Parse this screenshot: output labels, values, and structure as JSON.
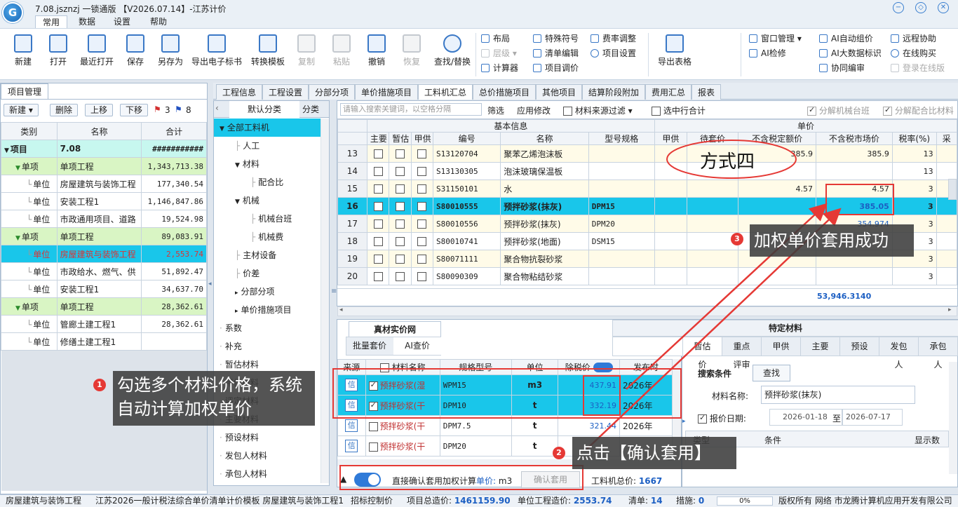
{
  "app": {
    "title": "7.08.jsznzj  一锁通版 【V2026.07.14】-江苏计价",
    "logo": "G"
  },
  "menu": [
    "常用",
    "数据",
    "设置",
    "帮助"
  ],
  "ribbon": {
    "big": [
      "新建",
      "打开",
      "最近打开",
      "保存",
      "另存为",
      "导出电子标书",
      "转换模板",
      "复制",
      "粘贴",
      "撤销",
      "恢复",
      "查找/替换"
    ],
    "small_col1": [
      "布局",
      "层级",
      "计算器"
    ],
    "small_col2": [
      "特殊符号",
      "清单编辑",
      "项目调价"
    ],
    "small_col3": [
      "费率调整",
      "项目设置"
    ],
    "export": "导出表格",
    "small_col4": [
      "窗口管理",
      "AI检修"
    ],
    "small_col5": [
      "AI自动组价",
      "AI大数据标识",
      "协同编审"
    ],
    "small_col6": [
      "远程协助",
      "在线购买",
      "登录在线版"
    ]
  },
  "left": {
    "tab": "项目管理",
    "buttons": [
      "新建",
      "删除",
      "上移",
      "下移"
    ],
    "flags": [
      "3",
      "8"
    ],
    "headers": [
      "类别",
      "名称",
      "合计"
    ],
    "rows": [
      {
        "cat": "项目",
        "name": "7.08",
        "total": "###########",
        "lvl": 0
      },
      {
        "cat": "单项",
        "name": "单项工程",
        "total": "1,343,713.38",
        "lvl": 1
      },
      {
        "cat": "单位",
        "name": "房屋建筑与装饰工程",
        "total": "177,340.54",
        "lvl": 2
      },
      {
        "cat": "单位",
        "name": "安装工程1",
        "total": "1,146,847.86",
        "lvl": 2
      },
      {
        "cat": "单位",
        "name": "市政通用项目、道路",
        "total": "19,524.98",
        "lvl": 2
      },
      {
        "cat": "单项",
        "name": "单项工程",
        "total": "89,083.91",
        "lvl": 1
      },
      {
        "cat": "单位",
        "name": "房屋建筑与装饰工程",
        "total": "2,553.74",
        "lvl": 2
      },
      {
        "cat": "单位",
        "name": "市政给水、燃气、供",
        "total": "51,892.47",
        "lvl": 2
      },
      {
        "cat": "单位",
        "name": "安装工程1",
        "total": "34,637.70",
        "lvl": 2
      },
      {
        "cat": "单项",
        "name": "单项工程",
        "total": "28,362.61",
        "lvl": 1
      },
      {
        "cat": "单位",
        "name": "管廊土建工程1",
        "total": "28,362.61",
        "lvl": 2
      },
      {
        "cat": "单位",
        "name": "修缮土建工程1",
        "total": "",
        "lvl": 2
      }
    ]
  },
  "tabs": [
    "工程信息",
    "工程设置",
    "分部分项",
    "单价措施项目",
    "工料机汇总",
    "总价措施项目",
    "其他项目",
    "结算阶段附加",
    "费用汇总",
    "报表"
  ],
  "mid": {
    "tabs": [
      "默认分类",
      "分类"
    ],
    "tree": [
      "全部工料机",
      "人工",
      "材料",
      "配合比",
      "机械",
      "机械台班",
      "机械费",
      "主材设备",
      "价差",
      "分部分项",
      "单价措施项目",
      "系数",
      "补充",
      "暂估材料",
      "甲供材料",
      "评定材料",
      "主要材料",
      "预设材料",
      "发包人材料",
      "承包人材料"
    ]
  },
  "toolbar": {
    "search_placeholder": "请输入搜索关键词，以空格分隔",
    "filter": "筛选",
    "apply": "应用修改",
    "source_filter": "材料来源过滤",
    "sel_total": "选中行合计",
    "split_machine": "分解机械台班",
    "split_mix": "分解配合比材料"
  },
  "table": {
    "group1": "基本信息",
    "group2": "单价",
    "headers": [
      "主要",
      "暂估",
      "甲供",
      "编号",
      "名称",
      "型号规格",
      "甲供",
      "待套价",
      "不含税定额价",
      "不含税市场价",
      "税率(%)",
      "采"
    ],
    "rows": [
      {
        "no": "13",
        "code": "S13120704",
        "name": "聚苯乙烯泡沫板",
        "spec": "",
        "quota": "385.9",
        "market": "385.9",
        "tax": "13"
      },
      {
        "no": "14",
        "code": "S13130305",
        "name": "泡沫玻璃保温板",
        "spec": "",
        "quota": "",
        "market": "",
        "tax": "13"
      },
      {
        "no": "15",
        "code": "S31150101",
        "name": "水",
        "spec": "",
        "quota": "4.57",
        "market": "4.57",
        "tax": "3"
      },
      {
        "no": "16",
        "code": "S80010555",
        "name": "预拌砂浆(抹灰)",
        "spec": "DPM15",
        "quota": "",
        "market": "385.05",
        "tax": "3"
      },
      {
        "no": "17",
        "code": "S80010556",
        "name": "预拌砂浆(抹灰)",
        "spec": "DPM20",
        "quota": "",
        "market": "354.974",
        "tax": "3"
      },
      {
        "no": "18",
        "code": "S80010741",
        "name": "预拌砂浆(地面)",
        "spec": "DSM15",
        "quota": "",
        "market": "",
        "tax": "3"
      },
      {
        "no": "19",
        "code": "S80071111",
        "name": "聚合物抗裂砂浆",
        "spec": "",
        "quota": "",
        "market": "",
        "tax": "3"
      },
      {
        "no": "20",
        "code": "S80090309",
        "name": "聚合物粘结砂浆",
        "spec": "",
        "quota": "",
        "market": "",
        "tax": "3"
      }
    ],
    "total": "53,946.3140"
  },
  "bottom": {
    "title": "真材实价网",
    "tabs": [
      "批量套价",
      "AI查价"
    ],
    "headers": [
      "来源",
      "材料名称",
      "规格型号",
      "单位",
      "除税价",
      "发布时"
    ],
    "rows": [
      {
        "src": "信",
        "name": "预拌砂浆(湿",
        "spec": "WPM15",
        "unit": "m3",
        "price": "437.91",
        "date": "2026年",
        "checked": true
      },
      {
        "src": "信",
        "name": "预拌砂浆(干",
        "spec": "DPM10",
        "unit": "t",
        "price": "332.19",
        "date": "2026年",
        "checked": true
      },
      {
        "src": "信",
        "name": "预拌砂浆(干",
        "spec": "DPM7.5",
        "unit": "t",
        "price": "321.44",
        "date": "2026年",
        "checked": false
      },
      {
        "src": "信",
        "name": "预拌砂浆(干",
        "spec": "DPM20",
        "unit": "t",
        "price": "",
        "date": "",
        "checked": false
      }
    ],
    "footer": {
      "label": "直接确认套用加权计算",
      "unit_label": "单价:",
      "unit": "m3",
      "btn": "确认套用",
      "total_label": "工料机总价:",
      "total": "1667"
    }
  },
  "special": {
    "title": "特定材料",
    "tabs": [
      "暂估价",
      "重点评审",
      "甲供",
      "主要",
      "预设",
      "发包人",
      "承包人"
    ],
    "search_label": "搜索条件",
    "search_btn": "查找",
    "name_label": "材料名称:",
    "name_value": "预拌砂浆(抹灰)",
    "date_label": "报价日期:",
    "date_from": "2026-01-18",
    "date_to": "2026-07-17",
    "date_sep": "至",
    "cols": [
      "类型",
      "条件",
      "显示数"
    ]
  },
  "callouts": {
    "c1": "勾选多个材料价格，系统自动计算加权单价",
    "c2": "点击【确认套用】",
    "c3": "加权单价套用成功",
    "method": "方式四"
  },
  "status": {
    "s1": "房屋建筑与装饰工程",
    "s2": "江苏2026一般计税法综合单价清单计价模板 房屋建筑与装饰工程1",
    "s3": "招标控制价",
    "s4_label": "项目总造价:",
    "s4": "1461159.90",
    "s5_label": "单位工程造价:",
    "s5": "2553.74",
    "s6_label": "清单:",
    "s6": "14",
    "s7_label": "措施:",
    "s7": "0",
    "pct": "0%",
    "copyright": "版权所有 网络 市龙腾计算机应用开发有限公司"
  }
}
